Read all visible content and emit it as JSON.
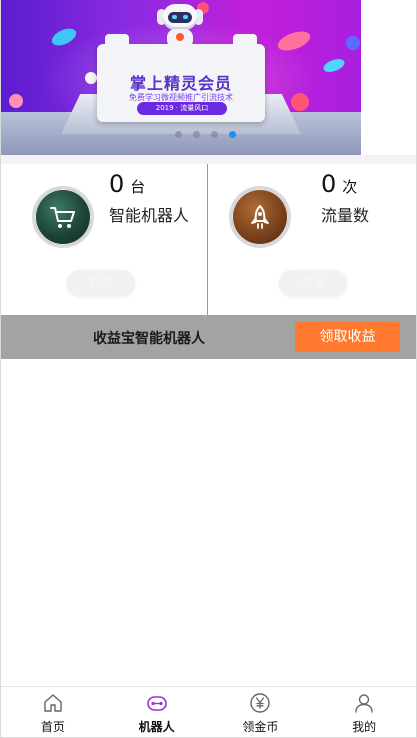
{
  "banner": {
    "title": "掌上精灵会员",
    "subtitle": "免费学习微视频推广引流技术",
    "pill": "2019 · 流量风口",
    "slide_count": 4,
    "active_slide": 3,
    "accent": "#1f8ff0"
  },
  "stats": [
    {
      "count": "0",
      "unit": "台",
      "label": "智能机器人",
      "icon": "shopping-cart-icon",
      "button_label": "购买"
    },
    {
      "count": "0",
      "unit": "次",
      "label": "流量数",
      "icon": "rocket-icon",
      "button_label": "充值"
    }
  ],
  "earnings": {
    "title": "收益宝智能机器人",
    "button_label": "领取收益",
    "button_color": "#ff7a2e"
  },
  "tabbar": {
    "items": [
      {
        "label": "首页",
        "icon": "home-icon"
      },
      {
        "label": "机器人",
        "icon": "robot-icon"
      },
      {
        "label": "领金币",
        "icon": "yen-coin-icon"
      },
      {
        "label": "我的",
        "icon": "user-icon"
      }
    ],
    "active_index": 1,
    "active_color": "#9b2fd6"
  }
}
